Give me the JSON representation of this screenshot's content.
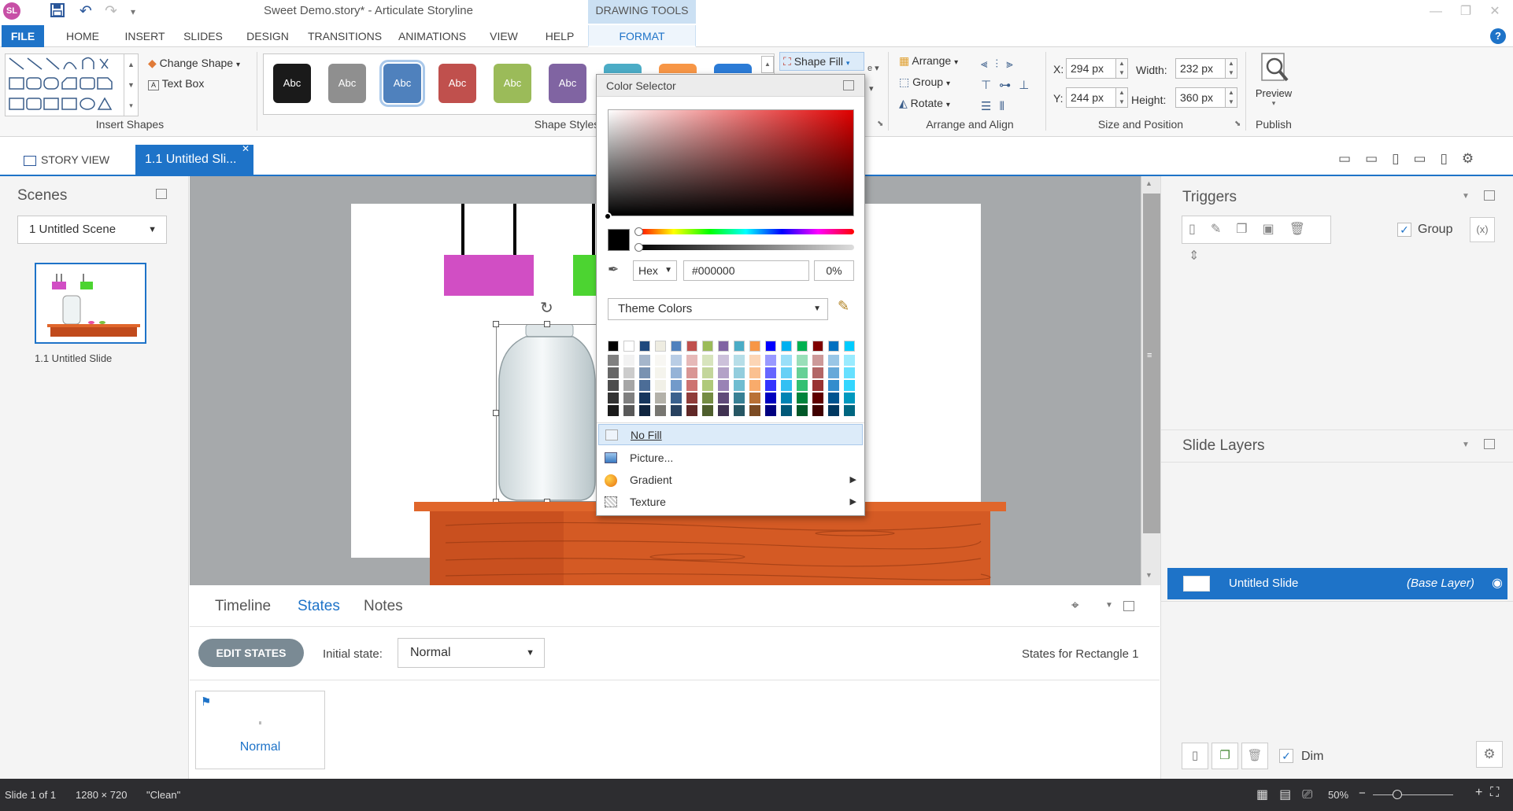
{
  "app": {
    "logo_text": "SL",
    "title": "Sweet Demo.story* - Articulate Storyline",
    "contextual_header": "DRAWING TOOLS"
  },
  "ribbon_tabs": [
    "FILE",
    "HOME",
    "INSERT",
    "SLIDES",
    "DESIGN",
    "TRANSITIONS",
    "ANIMATIONS",
    "VIEW",
    "HELP",
    "FORMAT"
  ],
  "ribbon": {
    "insert_shapes": {
      "change_shape": "Change Shape",
      "text_box": "Text Box",
      "label": "Insert Shapes"
    },
    "shape_styles": {
      "label": "Shape Styles",
      "shape_fill": "Shape Fill",
      "sample": "Abc",
      "styles": [
        {
          "bg": "#1a1a1a"
        },
        {
          "bg": "#8f8f8f"
        },
        {
          "bg": "#4f81bd",
          "selected": true
        },
        {
          "bg": "#c0504d"
        },
        {
          "bg": "#9bbb59"
        },
        {
          "bg": "#8064a2"
        }
      ]
    },
    "arrange": {
      "arrange": "Arrange",
      "group": "Group",
      "rotate": "Rotate",
      "label": "Arrange and Align"
    },
    "size_position": {
      "x_label": "X:",
      "x_value": "294 px",
      "y_label": "Y:",
      "y_value": "244 px",
      "width_label": "Width:",
      "width_value": "232 px",
      "height_label": "Height:",
      "height_value": "360 px",
      "label": "Size and Position"
    },
    "publish": {
      "preview": "Preview",
      "label": "Publish"
    }
  },
  "story_tabs": {
    "story_view": "STORY VIEW",
    "slide_tab": "1.1 Untitled Sli..."
  },
  "scenes": {
    "title": "Scenes",
    "dropdown": "1 Untitled Scene",
    "slide_label": "1.1 Untitled Slide"
  },
  "bottom": {
    "tabs": [
      "Timeline",
      "States",
      "Notes"
    ],
    "active_tab": "States",
    "edit_states": "EDIT STATES",
    "initial_state_label": "Initial state:",
    "initial_state_value": "Normal",
    "states_for": "States for Rectangle 1",
    "state_card": "Normal"
  },
  "triggers": {
    "title": "Triggers",
    "group": "Group"
  },
  "layers": {
    "title": "Slide Layers",
    "base_name": "Untitled Slide",
    "base_tag": "(Base Layer)",
    "dim": "Dim"
  },
  "status": {
    "slide": "Slide 1 of 1",
    "size": "1280 × 720",
    "theme": "\"Clean\"",
    "zoom": "50%"
  },
  "color_selector": {
    "title": "Color Selector",
    "mode": "Hex",
    "hex": "#000000",
    "transparency": "0%",
    "palette_name": "Theme Colors",
    "base_row": [
      "#000000",
      "#ffffff",
      "#1f497d",
      "#eeece1",
      "#4f81bd",
      "#c0504d",
      "#9bbb59",
      "#8064a2",
      "#4bacc6",
      "#f79646",
      "#0000ff",
      "#00b0f0",
      "#00b050",
      "#7f0000",
      "#0070c0",
      "#00ccff"
    ],
    "menu": [
      "No Fill",
      "Picture...",
      "Gradient",
      "Texture"
    ]
  }
}
